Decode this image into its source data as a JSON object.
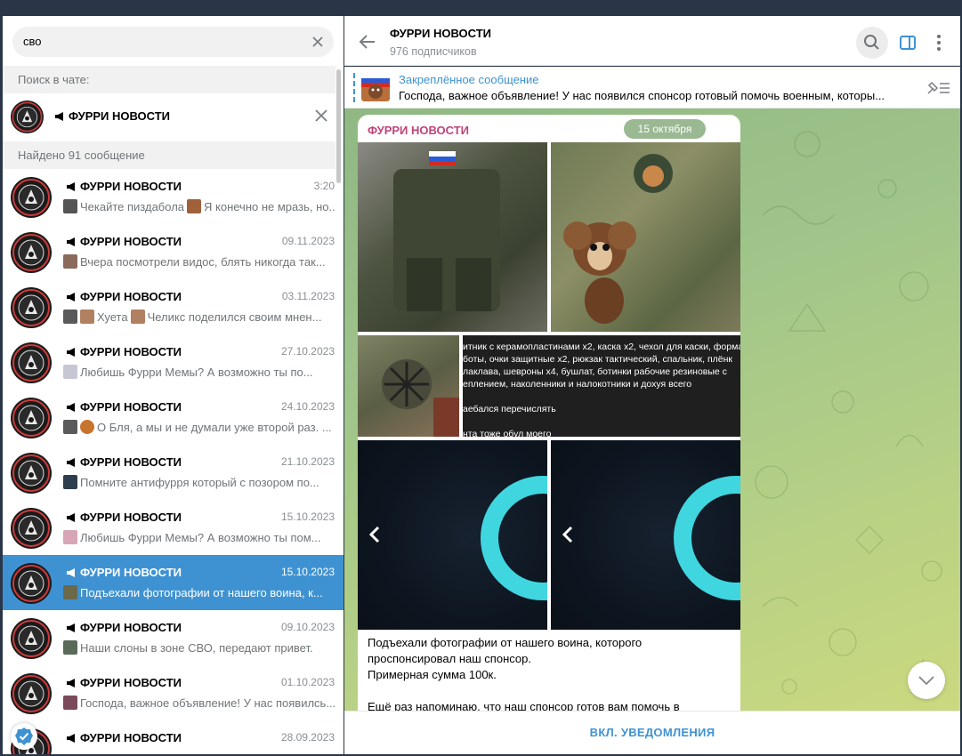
{
  "search": {
    "query": "сво"
  },
  "sidebar": {
    "search_in_chat_label": "Поиск в чате:",
    "chat_filter_name": "ФУРРИ НОВОСТИ",
    "found_label": "Найдено 91 сообщение",
    "results": [
      {
        "title": "ФУРРИ НОВОСТИ",
        "date": "3:20",
        "text": "Чекайте пиздабола",
        "text2": "Я конечно не мразь, но..."
      },
      {
        "title": "ФУРРИ НОВОСТИ",
        "date": "09.11.2023",
        "text": "Вчера посмотрели видос, блять никогда так..."
      },
      {
        "title": "ФУРРИ НОВОСТИ",
        "date": "03.11.2023",
        "text": "Хуета",
        "text2": "Челикс поделился своим мнен..."
      },
      {
        "title": "ФУРРИ НОВОСТИ",
        "date": "27.10.2023",
        "text": "Любишь Фурри Мемы?  А возможно ты по..."
      },
      {
        "title": "ФУРРИ НОВОСТИ",
        "date": "24.10.2023",
        "text": "О Бля, а мы и не думали уже второй раз. ..."
      },
      {
        "title": "ФУРРИ НОВОСТИ",
        "date": "21.10.2023",
        "text": "Помните антифурря который с позором по..."
      },
      {
        "title": "ФУРРИ НОВОСТИ",
        "date": "15.10.2023",
        "text": "Любишь Фурри Мемы? А возможно ты пом..."
      },
      {
        "title": "ФУРРИ НОВОСТИ",
        "date": "15.10.2023",
        "text": "Подъехали фотографии от нашего воина, к..."
      },
      {
        "title": "ФУРРИ НОВОСТИ",
        "date": "09.10.2023",
        "text": "Наши слоны в зоне СВО, передают привет."
      },
      {
        "title": "ФУРРИ НОВОСТИ",
        "date": "01.10.2023",
        "text": "Господа, важное объявление! У нас появилсь..."
      },
      {
        "title": "ФУРРИ НОВОСТИ",
        "date": "28.09.2023",
        "text": ""
      }
    ]
  },
  "header": {
    "title": "ФУРРИ НОВОСТИ",
    "subtitle": "976 подписчиков"
  },
  "pinned": {
    "title": "Закреплённое сообщение",
    "text": "Господа, важное объявление! У нас появился спонсор готовый помочь военным, которы..."
  },
  "message": {
    "author": "ФУРРИ НОВОСТИ",
    "date_pill": "15 октября",
    "screenshot_lines": [
      "итник с керамопластинами х2, каска х2, чехол для каски, форма",
      "боты, очки защитные х2, рюкзак тактический, спальник, плёнк",
      "лаклава, шевроны х4, бушлат, ботинки рабочие резиновые с",
      "еплением, наколенники и налокотники и дохуя всего",
      "",
      "аебался перечислять",
      "",
      "нта тоже обул моего"
    ],
    "text_lines": [
      "Подъехали фотографии от нашего воина, которого",
      "проспонсировал наш спонсор.",
      "Примерная сумма 100к.",
      "",
      "Ещё раз напоминаю, что наш спонсор готов вам помочь в"
    ]
  },
  "bottom": {
    "notify_label": "ВКЛ. УВЕДОМЛЕНИЯ"
  },
  "colors": {
    "accent": "#3f92d2",
    "active_row": "#3f92d2",
    "author": "#c0437a",
    "ring": "#3fd6e0"
  },
  "icons": [
    "clear-icon",
    "close-icon",
    "megaphone-icon",
    "back-icon",
    "search-icon",
    "sidebar-toggle-icon",
    "more-icon",
    "unpin-list-icon",
    "chevron-down-icon",
    "verified-icon",
    "chevron-left-icon"
  ]
}
